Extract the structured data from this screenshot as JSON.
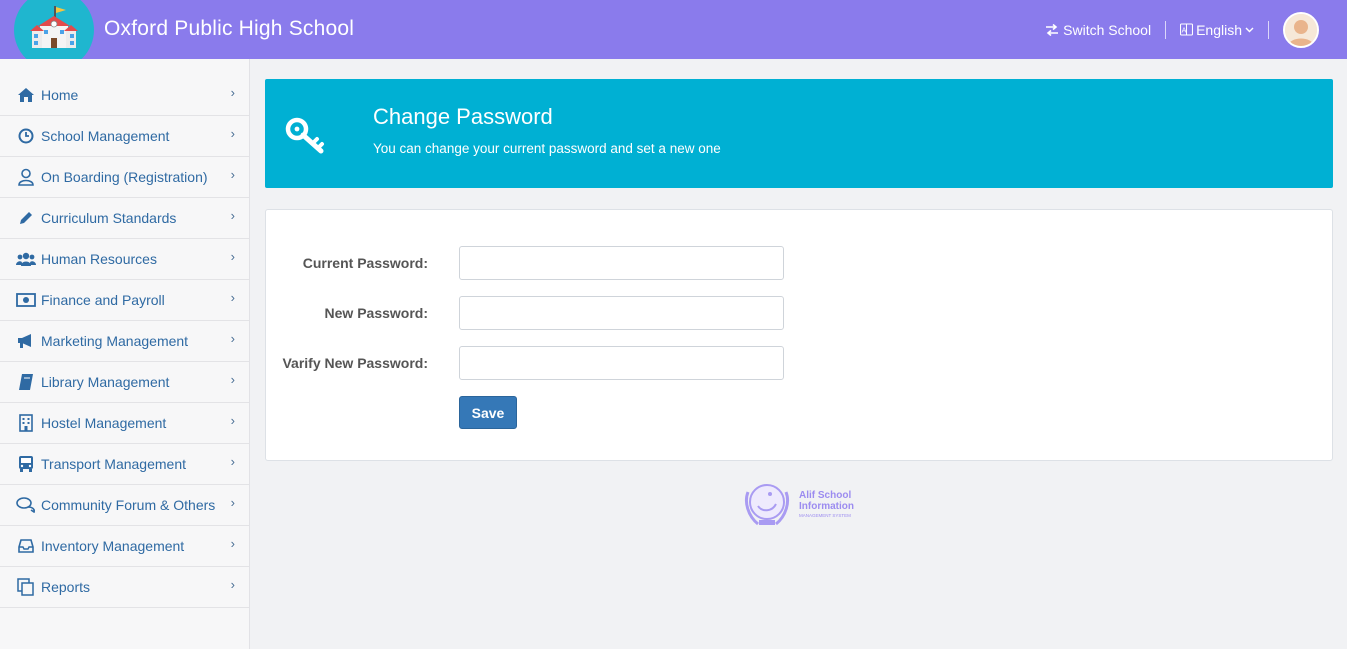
{
  "header": {
    "title": "Oxford Public High School",
    "switch_school": "Switch School",
    "language": "English",
    "logo_icon": "school-building-icon",
    "colors": {
      "topbar": "#8a7bec",
      "logo_bg": "#1fb6cf"
    }
  },
  "sidebar": {
    "items": [
      {
        "label": "Home",
        "icon": "home-icon"
      },
      {
        "label": "School Management",
        "icon": "clock-icon"
      },
      {
        "label": "On Boarding (Registration)",
        "icon": "user-outline-icon"
      },
      {
        "label": "Curriculum Standards",
        "icon": "pencil-icon"
      },
      {
        "label": "Human Resources",
        "icon": "users-icon"
      },
      {
        "label": "Finance and Payroll",
        "icon": "money-icon"
      },
      {
        "label": "Marketing Management",
        "icon": "bullhorn-icon"
      },
      {
        "label": "Library Management",
        "icon": "book-icon"
      },
      {
        "label": "Hostel Management",
        "icon": "building-icon"
      },
      {
        "label": "Transport Management",
        "icon": "bus-icon"
      },
      {
        "label": "Community Forum & Others",
        "icon": "comments-icon"
      },
      {
        "label": "Inventory Management",
        "icon": "inbox-icon"
      },
      {
        "label": "Reports",
        "icon": "copy-icon"
      }
    ]
  },
  "banner": {
    "title": "Change Password",
    "subtitle": "You can change your current password and set a new one",
    "icon": "key-icon",
    "color": "#00b0d3"
  },
  "form": {
    "current_password_label": "Current Password:",
    "new_password_label": "New Password:",
    "verify_password_label": "Varify New Password:",
    "current_password_value": "",
    "new_password_value": "",
    "verify_password_value": "",
    "save_label": "Save"
  },
  "footer": {
    "brand_line1": "Alif School",
    "brand_line2": "Information",
    "brand_sub": "MANAGEMENT SYSTEM"
  }
}
